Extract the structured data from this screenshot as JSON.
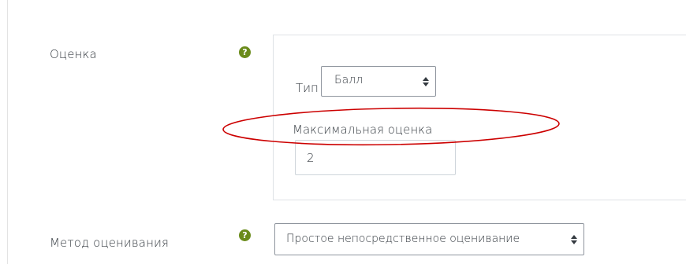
{
  "grade": {
    "label": "Оценка",
    "help_icon": "question-circle-icon",
    "type_label": "Тип",
    "type_select_value": "Балл",
    "max_grade_label": "Максимальная оценка",
    "max_grade_value": "2"
  },
  "grading_method": {
    "label": "Метод оценивания",
    "help_icon": "question-circle-icon",
    "select_value": "Простое непосредственное оценивание"
  },
  "colors": {
    "help_icon": "#6a8b1a",
    "annotation_ellipse": "#cc0000",
    "border": "#dee2e6"
  }
}
